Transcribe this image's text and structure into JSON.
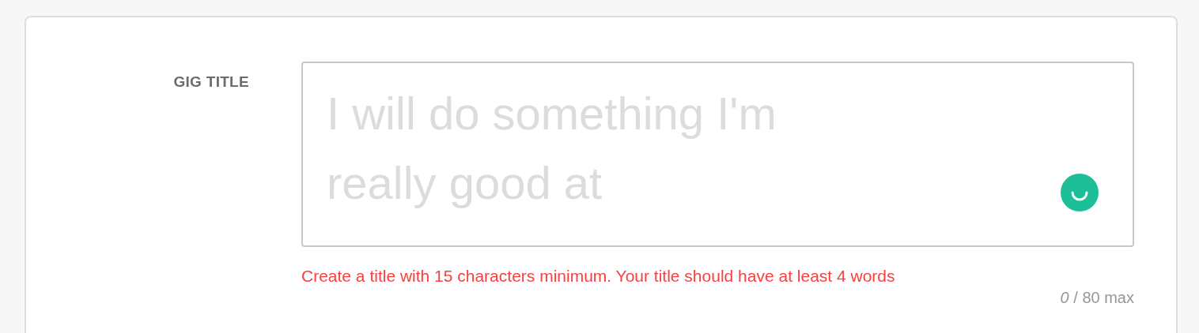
{
  "field": {
    "label": "GIG TITLE",
    "placeholder": "I will do something I'm really good at",
    "error": "Create a title with 15 characters minimum. Your title should have at least 4 words",
    "counter": "*0* / 80 max"
  }
}
